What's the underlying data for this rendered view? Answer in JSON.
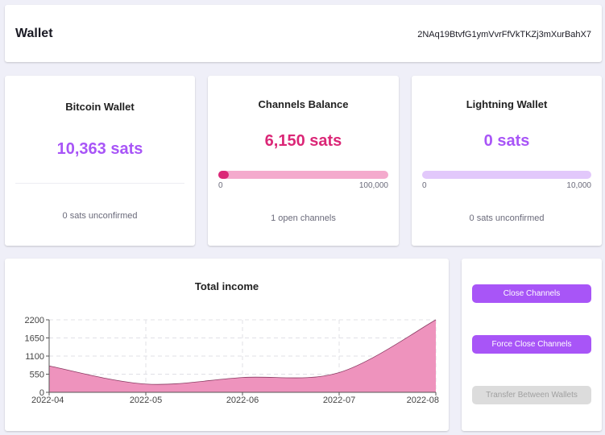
{
  "header": {
    "title": "Wallet",
    "address": "2NAq19BtvfG1ymVvrFfVkTKZj3mXurBahX7"
  },
  "bitcoin_wallet": {
    "title": "Bitcoin Wallet",
    "amount": "10,363 sats",
    "footer": "0 sats unconfirmed",
    "color": "#a855f7"
  },
  "channels_balance": {
    "title": "Channels Balance",
    "amount": "6,150 sats",
    "bar_min": "0",
    "bar_max": "100,000",
    "bar_fraction": 0.0615,
    "footer": "1 open channels",
    "color": "#db2777",
    "track_color": "#f4aacd"
  },
  "lightning_wallet": {
    "title": "Lightning Wallet",
    "amount": "0 sats",
    "bar_min": "0",
    "bar_max": "10,000",
    "bar_fraction": 0,
    "footer": "0 sats unconfirmed",
    "color": "#a855f7",
    "track_color": "#e2c8fb"
  },
  "income": {
    "title": "Total income"
  },
  "actions": {
    "close_channels": "Close Channels",
    "force_close_channels": "Force Close Channels",
    "transfer": "Transfer Between Wallets"
  },
  "chart_data": {
    "type": "area",
    "title": "Total income",
    "x": [
      "2022-04",
      "2022-05",
      "2022-06",
      "2022-07",
      "2022-08"
    ],
    "series": [
      {
        "values": [
          800,
          250,
          450,
          600,
          2200
        ]
      }
    ],
    "ylim": [
      0,
      2200
    ],
    "yticks": [
      0,
      550,
      1100,
      1650,
      2200
    ],
    "grid": true,
    "fill_color": "#ee93bd",
    "line_color": "#8a3a62"
  }
}
